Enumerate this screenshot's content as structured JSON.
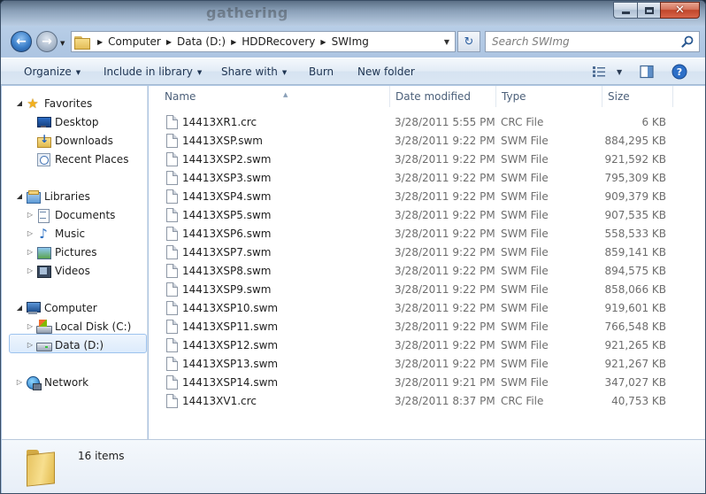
{
  "window": {
    "title_ghost": "gathering"
  },
  "address": {
    "crumbs": [
      "Computer",
      "Data (D:)",
      "HDDRecovery",
      "SWImg"
    ]
  },
  "search": {
    "placeholder": "Search SWImg"
  },
  "toolbar": {
    "organize": "Organize",
    "include_in_library": "Include in library",
    "share_with": "Share with",
    "burn": "Burn",
    "new_folder": "New folder"
  },
  "nav": {
    "favorites": "Favorites",
    "desktop": "Desktop",
    "downloads": "Downloads",
    "recent_places": "Recent Places",
    "libraries": "Libraries",
    "documents": "Documents",
    "music": "Music",
    "pictures": "Pictures",
    "videos": "Videos",
    "computer": "Computer",
    "local_disk": "Local Disk (C:)",
    "data_drive": "Data (D:)",
    "network": "Network"
  },
  "columns": {
    "name": "Name",
    "date_modified": "Date modified",
    "type": "Type",
    "size": "Size"
  },
  "files": [
    {
      "name": "14413XR1.crc",
      "date": "3/28/2011 5:55 PM",
      "type": "CRC File",
      "size": "6 KB"
    },
    {
      "name": "14413XSP.swm",
      "date": "3/28/2011 9:22 PM",
      "type": "SWM File",
      "size": "884,295 KB"
    },
    {
      "name": "14413XSP2.swm",
      "date": "3/28/2011 9:22 PM",
      "type": "SWM File",
      "size": "921,592 KB"
    },
    {
      "name": "14413XSP3.swm",
      "date": "3/28/2011 9:22 PM",
      "type": "SWM File",
      "size": "795,309 KB"
    },
    {
      "name": "14413XSP4.swm",
      "date": "3/28/2011 9:22 PM",
      "type": "SWM File",
      "size": "909,379 KB"
    },
    {
      "name": "14413XSP5.swm",
      "date": "3/28/2011 9:22 PM",
      "type": "SWM File",
      "size": "907,535 KB"
    },
    {
      "name": "14413XSP6.swm",
      "date": "3/28/2011 9:22 PM",
      "type": "SWM File",
      "size": "558,533 KB"
    },
    {
      "name": "14413XSP7.swm",
      "date": "3/28/2011 9:22 PM",
      "type": "SWM File",
      "size": "859,141 KB"
    },
    {
      "name": "14413XSP8.swm",
      "date": "3/28/2011 9:22 PM",
      "type": "SWM File",
      "size": "894,575 KB"
    },
    {
      "name": "14413XSP9.swm",
      "date": "3/28/2011 9:22 PM",
      "type": "SWM File",
      "size": "858,066 KB"
    },
    {
      "name": "14413XSP10.swm",
      "date": "3/28/2011 9:22 PM",
      "type": "SWM File",
      "size": "919,601 KB"
    },
    {
      "name": "14413XSP11.swm",
      "date": "3/28/2011 9:22 PM",
      "type": "SWM File",
      "size": "766,548 KB"
    },
    {
      "name": "14413XSP12.swm",
      "date": "3/28/2011 9:22 PM",
      "type": "SWM File",
      "size": "921,265 KB"
    },
    {
      "name": "14413XSP13.swm",
      "date": "3/28/2011 9:22 PM",
      "type": "SWM File",
      "size": "921,267 KB"
    },
    {
      "name": "14413XSP14.swm",
      "date": "3/28/2011 9:21 PM",
      "type": "SWM File",
      "size": "347,027 KB"
    },
    {
      "name": "14413XV1.crc",
      "date": "3/28/2011 8:37 PM",
      "type": "CRC File",
      "size": "40,753 KB"
    }
  ],
  "status": {
    "item_count": "16 items"
  },
  "icons": {
    "back": "back-arrow-icon",
    "forward": "forward-arrow-icon",
    "refresh": "refresh-icon",
    "search": "search-icon",
    "view": "view-options-icon",
    "preview_pane": "preview-pane-icon",
    "help": "help-icon"
  },
  "colors": {
    "selection_border": "#9dc3ee",
    "toolbar_text": "#1e3452",
    "header_text": "#4c607a"
  }
}
